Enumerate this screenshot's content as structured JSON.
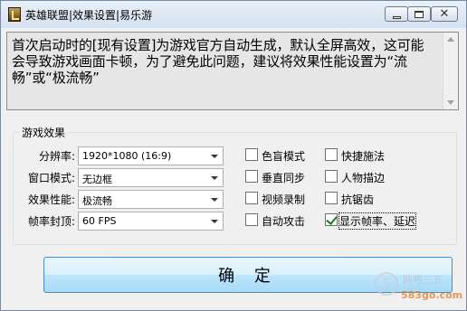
{
  "window": {
    "title": "英雄联盟|效果设置|易乐游",
    "close_glyph": "✕"
  },
  "info": {
    "text": "首次启动时的[现有设置]为游戏官方自动生成，默认全屏高效，这可能会导致游戏画面卡顿，为了避免此问题，建议将效果性能设置为“流畅”或“极流畅”"
  },
  "effects": {
    "group_label": "游戏效果",
    "rows": [
      {
        "label": "分辨率:",
        "value": "1920*1080 (16:9)"
      },
      {
        "label": "窗口模式:",
        "value": "无边框"
      },
      {
        "label": "效果性能:",
        "value": "极流畅"
      },
      {
        "label": "帧率封顶:",
        "value": "60 FPS"
      }
    ],
    "checkboxes": [
      {
        "label": "色盲模式",
        "checked": false
      },
      {
        "label": "快捷施法",
        "checked": false
      },
      {
        "label": "垂直同步",
        "checked": false
      },
      {
        "label": "人物描边",
        "checked": false
      },
      {
        "label": "视频录制",
        "checked": false
      },
      {
        "label": "抗锯齿",
        "checked": false
      },
      {
        "label": "自动攻击",
        "checked": false
      },
      {
        "label": "显示帧率、延迟",
        "checked": true
      }
    ]
  },
  "ok_button": {
    "label": "确 定"
  },
  "watermark": {
    "logo": "5",
    "site_name": "网吧三五",
    "url": "583go.com"
  },
  "colors": {
    "accent": "#4f8bc8",
    "check": "#1e7a1e",
    "watermark_url": "#e07a2a"
  }
}
